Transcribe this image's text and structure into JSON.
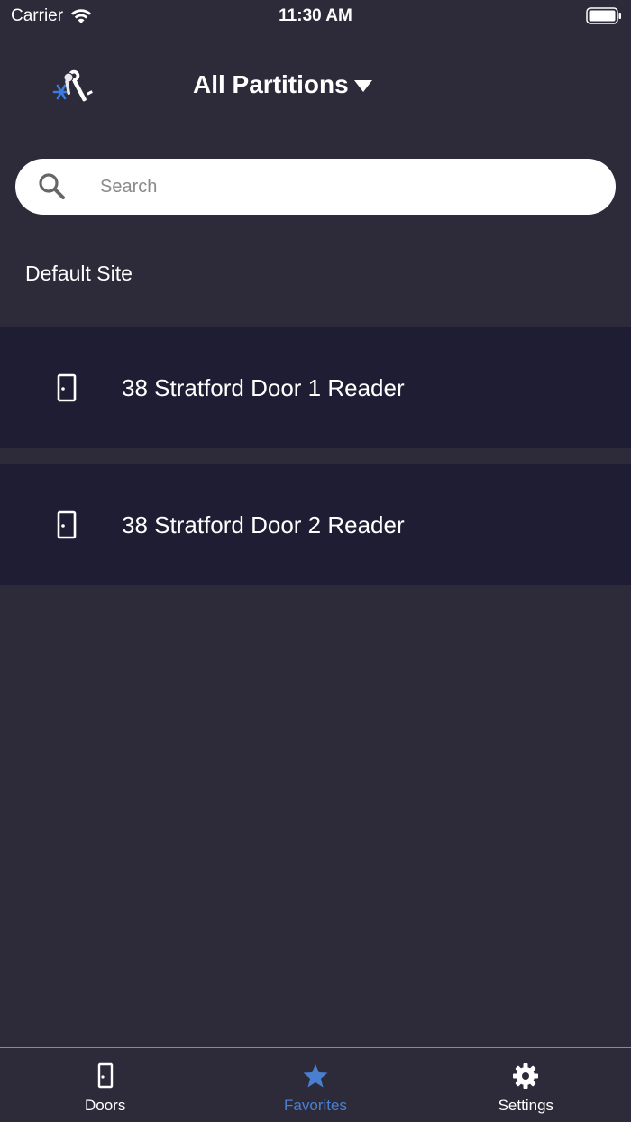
{
  "status_bar": {
    "carrier": "Carrier",
    "time": "11:30 AM"
  },
  "header": {
    "partition_label": "All Partitions",
    "logo_icon": "snowflake-key-icon"
  },
  "search": {
    "placeholder": "Search",
    "value": ""
  },
  "site": {
    "title": "Default Site",
    "doors": [
      {
        "label": "38 Stratford Door 1 Reader",
        "icon": "door-icon"
      },
      {
        "label": "38 Stratford Door 2 Reader",
        "icon": "door-icon"
      }
    ]
  },
  "tabs": [
    {
      "label": "Doors",
      "icon": "door-icon",
      "active": false
    },
    {
      "label": "Favorites",
      "icon": "star-icon",
      "active": true
    },
    {
      "label": "Settings",
      "icon": "gear-icon",
      "active": false
    }
  ],
  "colors": {
    "background": "#2d2b3a",
    "row_background": "#1f1d33",
    "accent": "#4a7fd0",
    "text": "#ffffff"
  }
}
